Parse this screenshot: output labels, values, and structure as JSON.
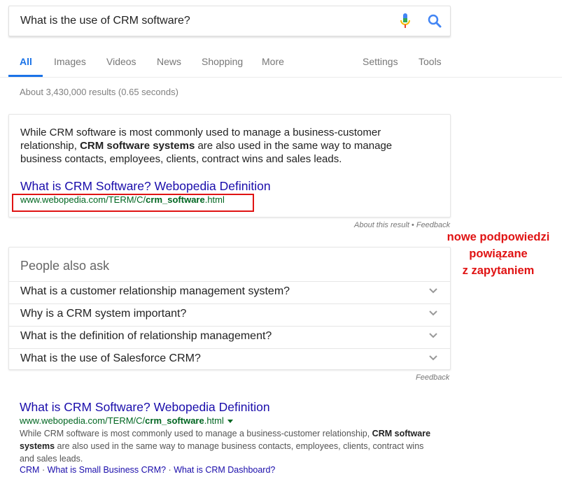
{
  "search": {
    "query": "What is the use of CRM software?"
  },
  "tabs": {
    "items": [
      "All",
      "Images",
      "Videos",
      "News",
      "Shopping",
      "More"
    ],
    "settings": "Settings",
    "tools": "Tools"
  },
  "stats": "About 3,430,000 results (0.65 seconds)",
  "featured": {
    "text_before": "While CRM software is most commonly used to manage a business-customer relationship, ",
    "text_bold": "CRM software systems",
    "text_after": " are also used in the same way to manage business contacts, employees, clients, contract wins and sales leads.",
    "title": "What is CRM Software? Webopedia Definition",
    "url_prefix": "www.webopedia.com/TERM/C/",
    "url_bold": "crm_software",
    "url_suffix": ".html",
    "footer_about": "About this result",
    "footer_sep": " • ",
    "footer_feedback": "Feedback"
  },
  "annotation": {
    "line1": "nowe podpowiedzi",
    "line2": "powiązane",
    "line3": "z zapytaniem"
  },
  "paa": {
    "title": "People also ask",
    "questions": [
      "What is a customer relationship management system?",
      "Why is a CRM system important?",
      "What is the definition of relationship management?",
      "What is the use of Salesforce CRM?"
    ],
    "feedback": "Feedback"
  },
  "result": {
    "title": "What is CRM Software? Webopedia Definition",
    "url_prefix": "www.webopedia.com/TERM/C/",
    "url_bold": "crm_software",
    "url_suffix": ".html",
    "desc_before": "While CRM software is most commonly used to manage a business-customer relationship, ",
    "desc_bold": "CRM software systems",
    "desc_after": " are also used in the same way to manage business contacts, employees, clients, contract wins and sales leads.",
    "sitelinks": [
      "CRM",
      "What is Small Business CRM?",
      "What is CRM Dashboard?"
    ],
    "sitelink_sep": " · "
  },
  "colors": {
    "link": "#1a0dab",
    "url": "#006621",
    "accent": "#1a73e8",
    "highlight": "#e01313"
  }
}
